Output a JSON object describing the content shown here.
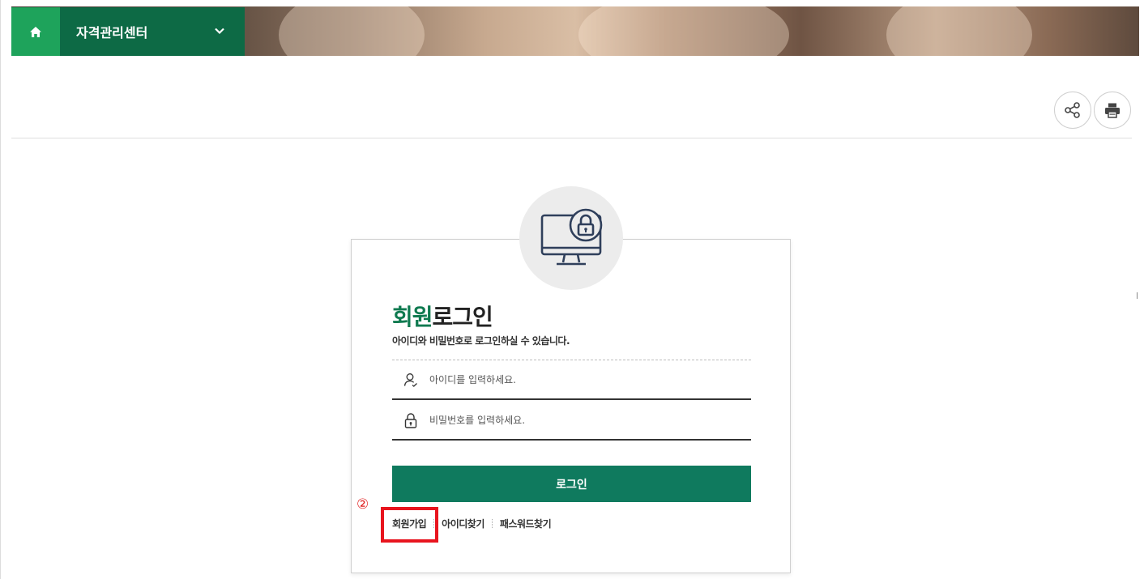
{
  "header": {
    "home_icon": "home-icon",
    "section_label": "자격관리센터",
    "dropdown_icon": "chevron-down-icon",
    "accent_home": "#1ea35b",
    "accent_section": "#0d6a45"
  },
  "tools": {
    "share_icon": "share-icon",
    "print_icon": "print-icon"
  },
  "login": {
    "title_accent": "회원",
    "title_rest": "로그인",
    "subtitle": "아이디와 비밀번호로 로그인하실 수 있습니다.",
    "id_placeholder": "아이디를 입력하세요.",
    "pw_placeholder": "비밀번호를 입력하세요.",
    "submit_label": "로그인",
    "button_color": "#0f7a5e",
    "links": {
      "signup": "회원가입",
      "find_id": "아이디찾기",
      "find_pw": "패스워드찾기"
    }
  },
  "annotation": {
    "number": "②",
    "color": "#e8141e"
  }
}
